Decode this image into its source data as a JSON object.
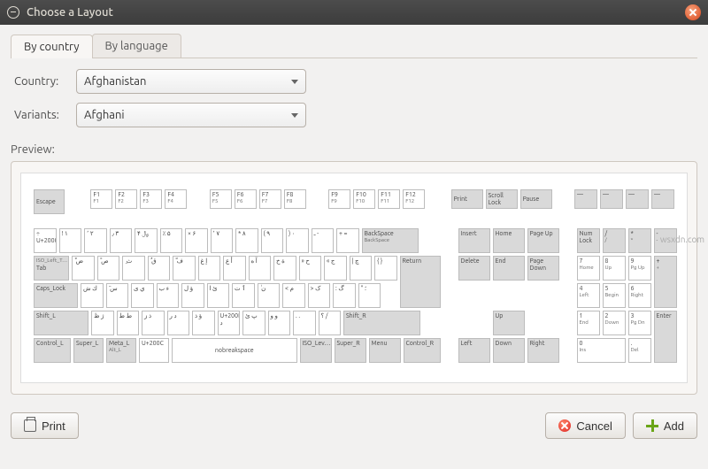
{
  "window": {
    "title": "Choose a Layout"
  },
  "tabs": {
    "by_country": "By country",
    "by_language": "By language"
  },
  "form": {
    "country_label": "Country:",
    "country_value": "Afghanistan",
    "variants_label": "Variants:",
    "variants_value": "Afghani"
  },
  "preview_label": "Preview:",
  "keys": {
    "escape": "Escape",
    "f1": "F1",
    "f2": "F2",
    "f3": "F3",
    "f4": "F4",
    "f5": "F5",
    "f6": "F6",
    "f7": "F7",
    "f8": "F8",
    "f9": "F9",
    "f10": "F10",
    "f11": "F11",
    "f12": "F12",
    "print": "Print",
    "scroll_lock": "Scroll Lock",
    "pause": "Pause",
    "backspace": "BackSpace",
    "backspace2": "BackSpace",
    "tab": "Tab",
    "iso_left": "ISO_Left_T…",
    "return": "Return",
    "caps": "Caps_Lock",
    "shift_l": "Shift_L",
    "shift_r": "Shift_R",
    "ctrl_l": "Control_L",
    "super_l": "Super_L",
    "meta_l": "Meta_L",
    "alt_l": "Alt_L",
    "space": "nobreakspace",
    "u200c": "U+200C",
    "iso_lev": "ISO_Lev…",
    "super_r": "Super_R",
    "menu": "Menu",
    "ctrl_r": "Control_R",
    "insert": "Insert",
    "home": "Home",
    "pgup": "Page Up",
    "delete": "Delete",
    "end": "End",
    "pgdn": "Page Down",
    "up": "Up",
    "down": "Down",
    "left": "Left",
    "right": "Right",
    "numlock": "Num Lock",
    "kp_div": "/",
    "kp_mul": "*",
    "kp_sub": "-",
    "kp_add": "+",
    "kp7": "7",
    "kp7_2": "Home",
    "kp8": "8",
    "kp8_2": "Up",
    "kp9": "9",
    "kp9_2": "Pg Up",
    "kp4": "4",
    "kp4_2": "Left",
    "kp5": "5",
    "kp5_2": "Begin",
    "kp6": "6",
    "kp6_2": "Right",
    "kp1": "1",
    "kp1_2": "End",
    "kp2": "2",
    "kp2_2": "Down",
    "kp3": "3",
    "kp3_2": "Pg Dn",
    "kp0": "0",
    "kp0_2": "Ins",
    "kp_dec": ".",
    "kp_dec2": "Del",
    "enter": "Enter",
    "row1": [
      "÷ U+2000",
      "! ۱",
      "٬ ۲",
      "٫ ۳",
      "﷼ ۴",
      "٪ ۵",
      "× ۶",
      "٬ ۷",
      "* ۸",
      "( ۹",
      ") ۰",
      "ـ -",
      "+ ="
    ],
    "row2": [
      "ْ ض",
      "ً ص",
      "ِ ث",
      "ُ ق",
      "ّ ف",
      "إ غ",
      "أ ع",
      "آ ه",
      "ة خ",
      "» ح",
      "« ج",
      "| چ",
      "{ }"
    ],
    "row3": [
      "ك ش",
      "ٓ س",
      "ي ی",
      "ء ب",
      "ؤ ل",
      "ئ ا",
      "ٱ ت",
      "ٰ ن",
      "< م",
      "> ک",
      ": گ",
      "\" ؛"
    ],
    "row4": [
      "ژ ظ",
      "ط ط",
      "ذ ز",
      "د ر",
      "ؤ ذ",
      "U+200D د",
      "پ ئ",
      "و و",
      ". .",
      "؟ /"
    ]
  },
  "buttons": {
    "print": "Print",
    "cancel": "Cancel",
    "add": "Add"
  },
  "watermark": "wsxdn.com"
}
